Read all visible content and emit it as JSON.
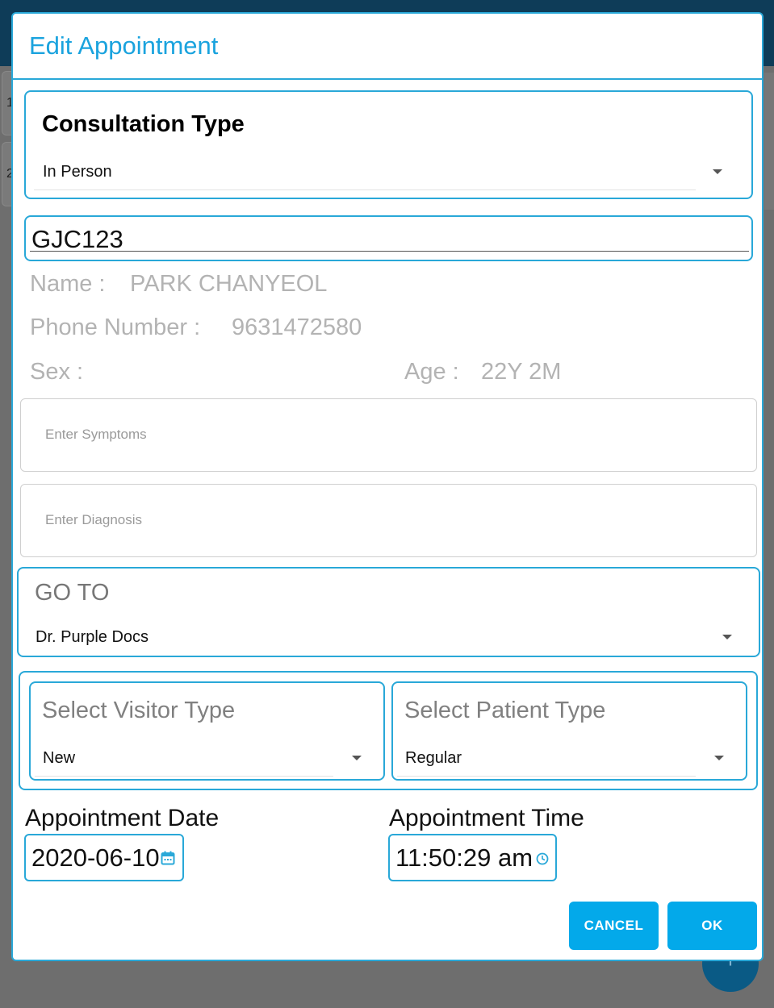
{
  "background": {
    "card_labels": [
      "1",
      "2"
    ],
    "fab_icon": "plus-icon"
  },
  "dialog": {
    "title": "Edit Appointment",
    "consultation": {
      "label": "Consultation Type",
      "value": "In Person"
    },
    "patient_id": {
      "value": "GJC123"
    },
    "patient": {
      "name_label": "Name :",
      "name_value": "PARK CHANYEOL",
      "phone_label": "Phone Number :",
      "phone_value": "9631472580",
      "sex_label": "Sex :",
      "sex_value": "",
      "age_label": "Age :",
      "age_value": "22Y 2M"
    },
    "symptoms": {
      "placeholder": "Enter Symptoms"
    },
    "diagnosis": {
      "placeholder": "Enter Diagnosis"
    },
    "goto": {
      "label": "GO TO",
      "value": "Dr. Purple Docs"
    },
    "visitor_type": {
      "label": "Select Visitor Type",
      "value": "New"
    },
    "patient_type": {
      "label": "Select Patient Type",
      "value": "Regular"
    },
    "appointment_date": {
      "label": "Appointment Date",
      "value": "2020-06-10",
      "icon": "calendar-icon"
    },
    "appointment_time": {
      "label": "Appointment Time",
      "value": "11:50:29 am",
      "icon": "clock-icon"
    },
    "buttons": {
      "cancel": "CANCEL",
      "ok": "OK"
    }
  },
  "colors": {
    "accent": "#29a8d8",
    "title": "#1aa3de",
    "button": "#03a9ea",
    "muted_text": "#b3b3b3"
  }
}
